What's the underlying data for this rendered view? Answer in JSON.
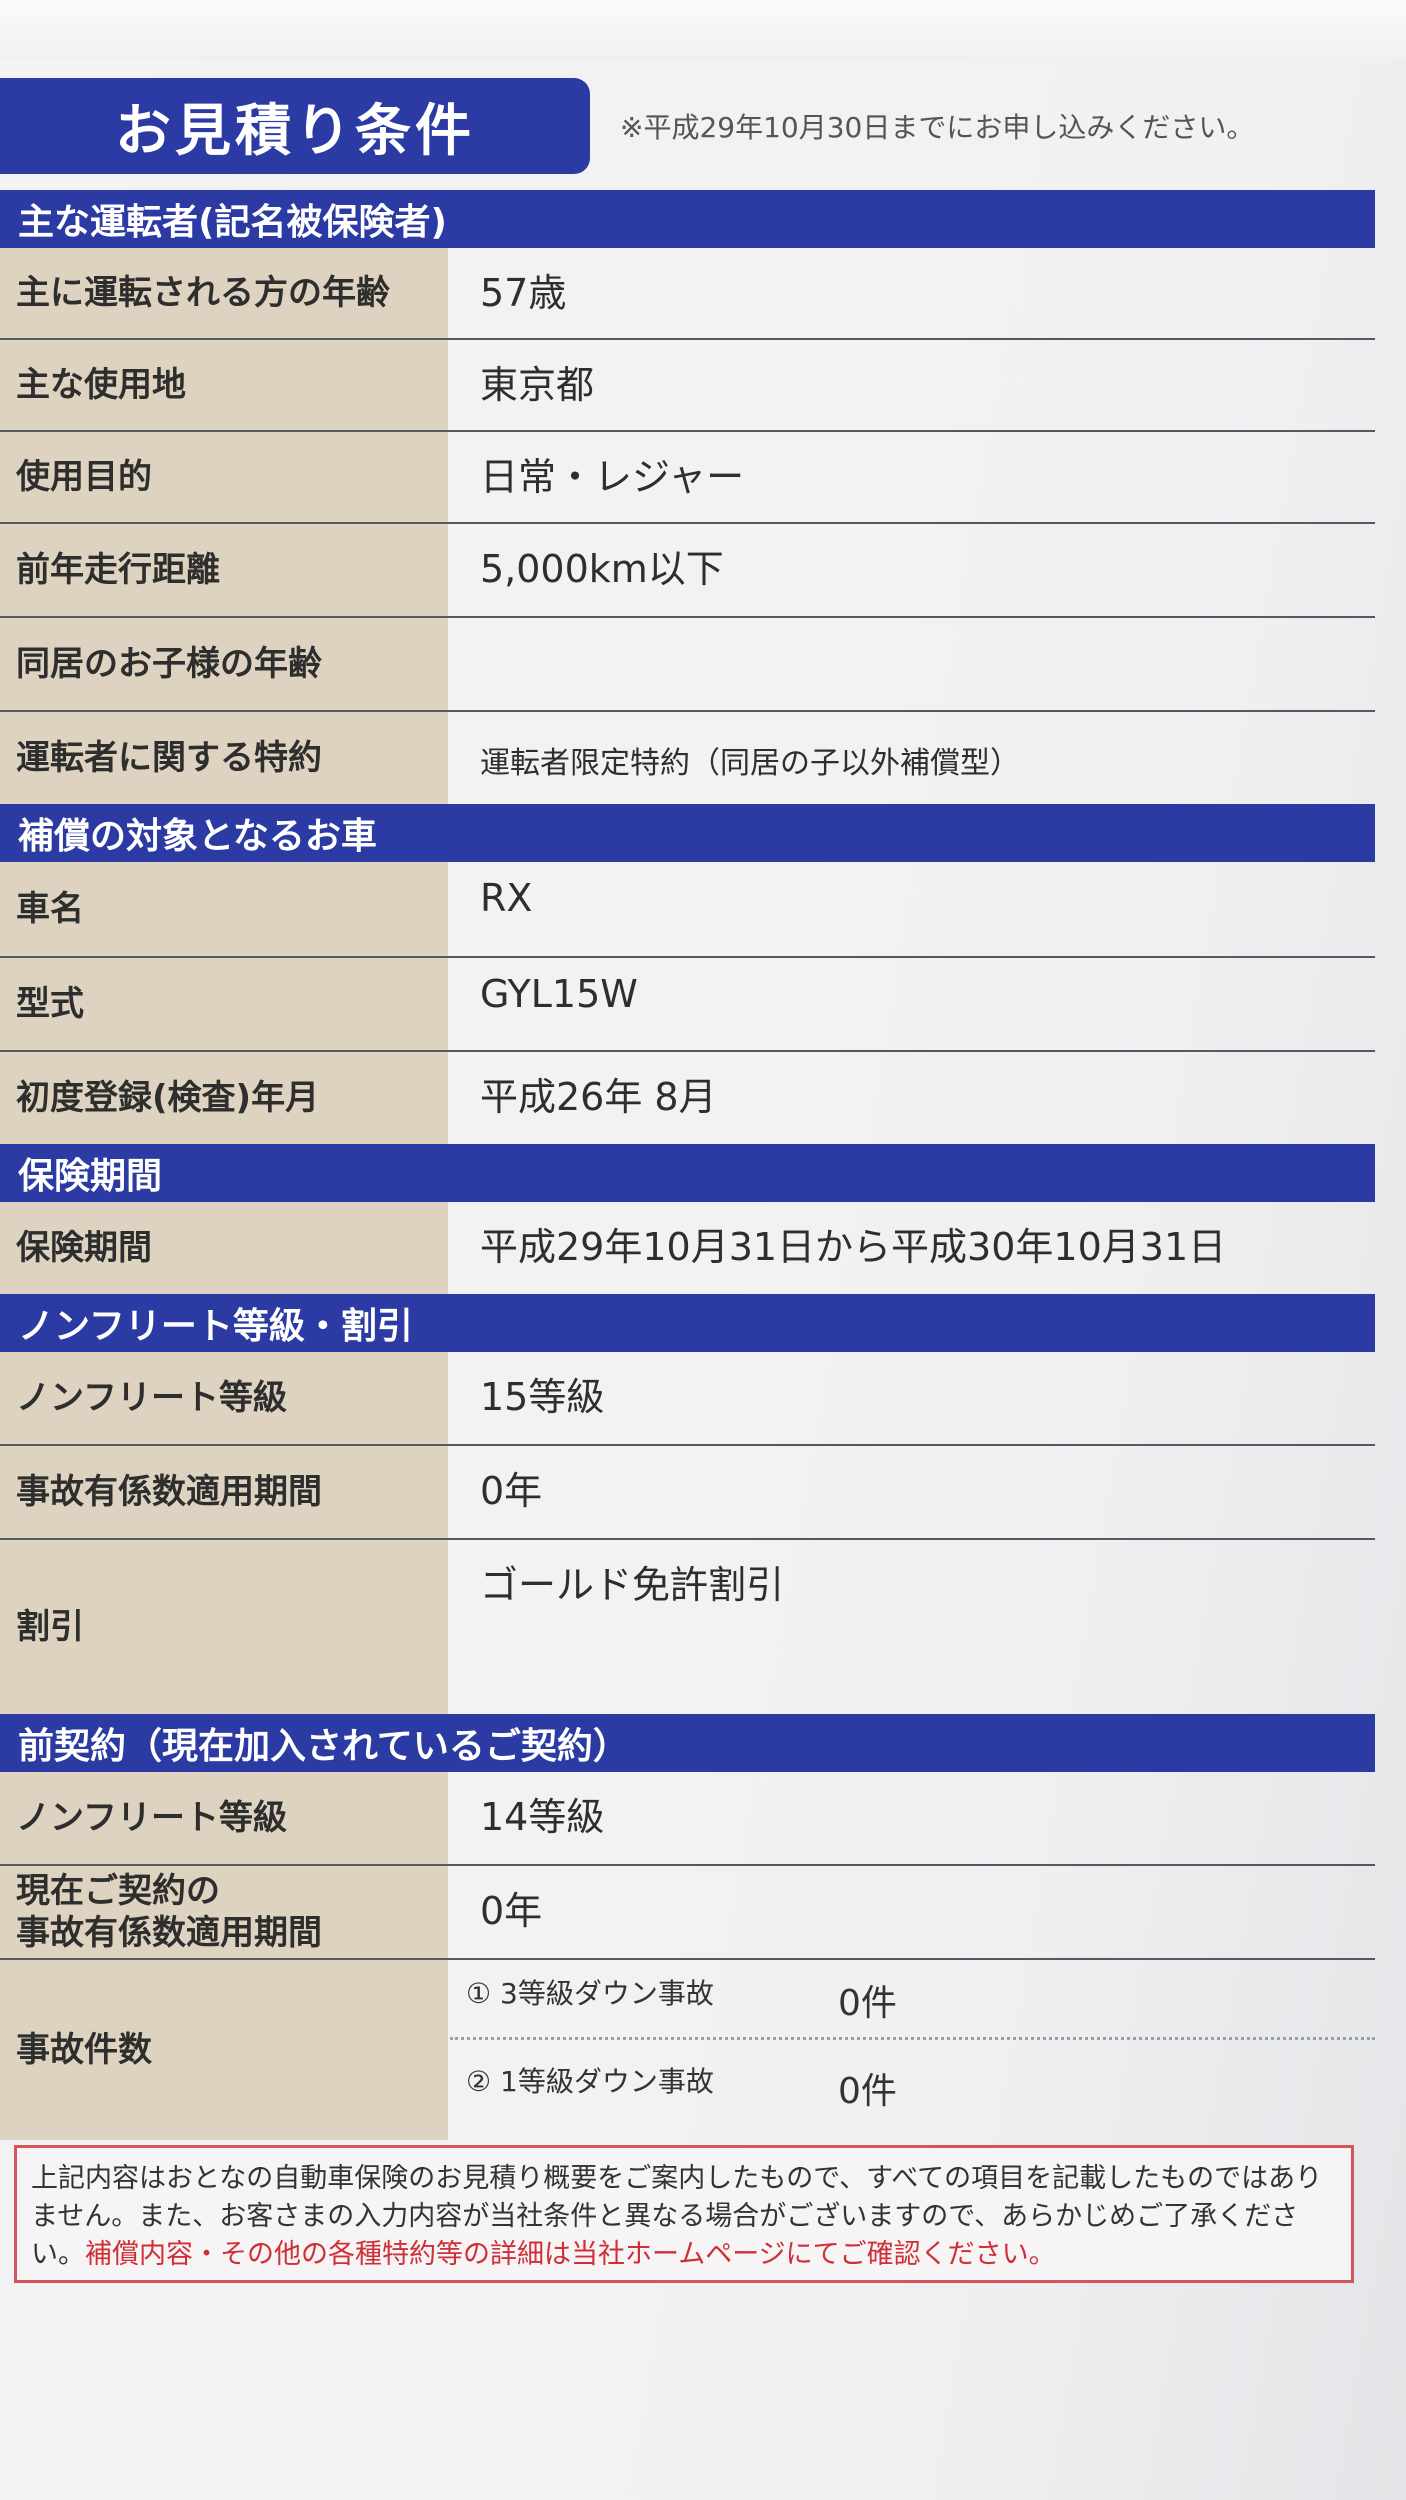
{
  "title": "お見積り条件",
  "deadline_note": "※平成29年10月30日までにお申し込みください。",
  "sections": {
    "main_driver": {
      "header": "主な運転者(記名被保険者)",
      "rows": [
        {
          "label": "主に運転される方の年齢",
          "value": "57歳"
        },
        {
          "label": "主な使用地",
          "value": "東京都"
        },
        {
          "label": "使用目的",
          "value": "日常・レジャー"
        },
        {
          "label": "前年走行距離",
          "value": "5,000km以下"
        },
        {
          "label": "同居のお子様の年齢",
          "value": ""
        },
        {
          "label": "運転者に関する特約",
          "value": "運転者限定特約（同居の子以外補償型）"
        }
      ]
    },
    "vehicle": {
      "header": "補償の対象となるお車",
      "rows": [
        {
          "label": "車名",
          "value": "RX"
        },
        {
          "label": "型式",
          "value": "GYL15W"
        },
        {
          "label": "初度登録(検査)年月",
          "value": "平成26年 8月"
        }
      ]
    },
    "period": {
      "header": "保険期間",
      "rows": [
        {
          "label": "保険期間",
          "value": "平成29年10月31日から平成30年10月31日"
        }
      ]
    },
    "nonfleet": {
      "header": "ノンフリート等級・割引",
      "rows": [
        {
          "label": "ノンフリート等級",
          "value": "15等級"
        },
        {
          "label": "事故有係数適用期間",
          "value": "0年"
        },
        {
          "label": "割引",
          "value": "ゴールド免許割引"
        }
      ]
    },
    "previous": {
      "header": "前契約（現在加入されているご契約）",
      "rows": [
        {
          "label": "ノンフリート等級",
          "value": "14等級"
        },
        {
          "label_line1": "現在ご契約の",
          "label_line2": "事故有係数適用期間",
          "value": "0年"
        },
        {
          "label": "事故件数",
          "items": [
            {
              "name": "① 3等級ダウン事故",
              "count": "0件"
            },
            {
              "name": "② 1等級ダウン事故",
              "count": "0件"
            }
          ]
        }
      ]
    }
  },
  "footer_note": {
    "text": "上記内容はおとなの自動車保険のお見積り概要をご案内したもので、すべての項目を記載したものではありません。また、お客さまの入力内容が当社条件と異なる場合がございますので、あらかじめご了承ください。",
    "red_text": "補償内容・その他の各種特約等の詳細は当社ホームページにてご確認ください。"
  },
  "colors": {
    "header_blue": "#2b3ba3",
    "label_beige": "#ddd3c0",
    "note_red": "#cf2f37"
  }
}
